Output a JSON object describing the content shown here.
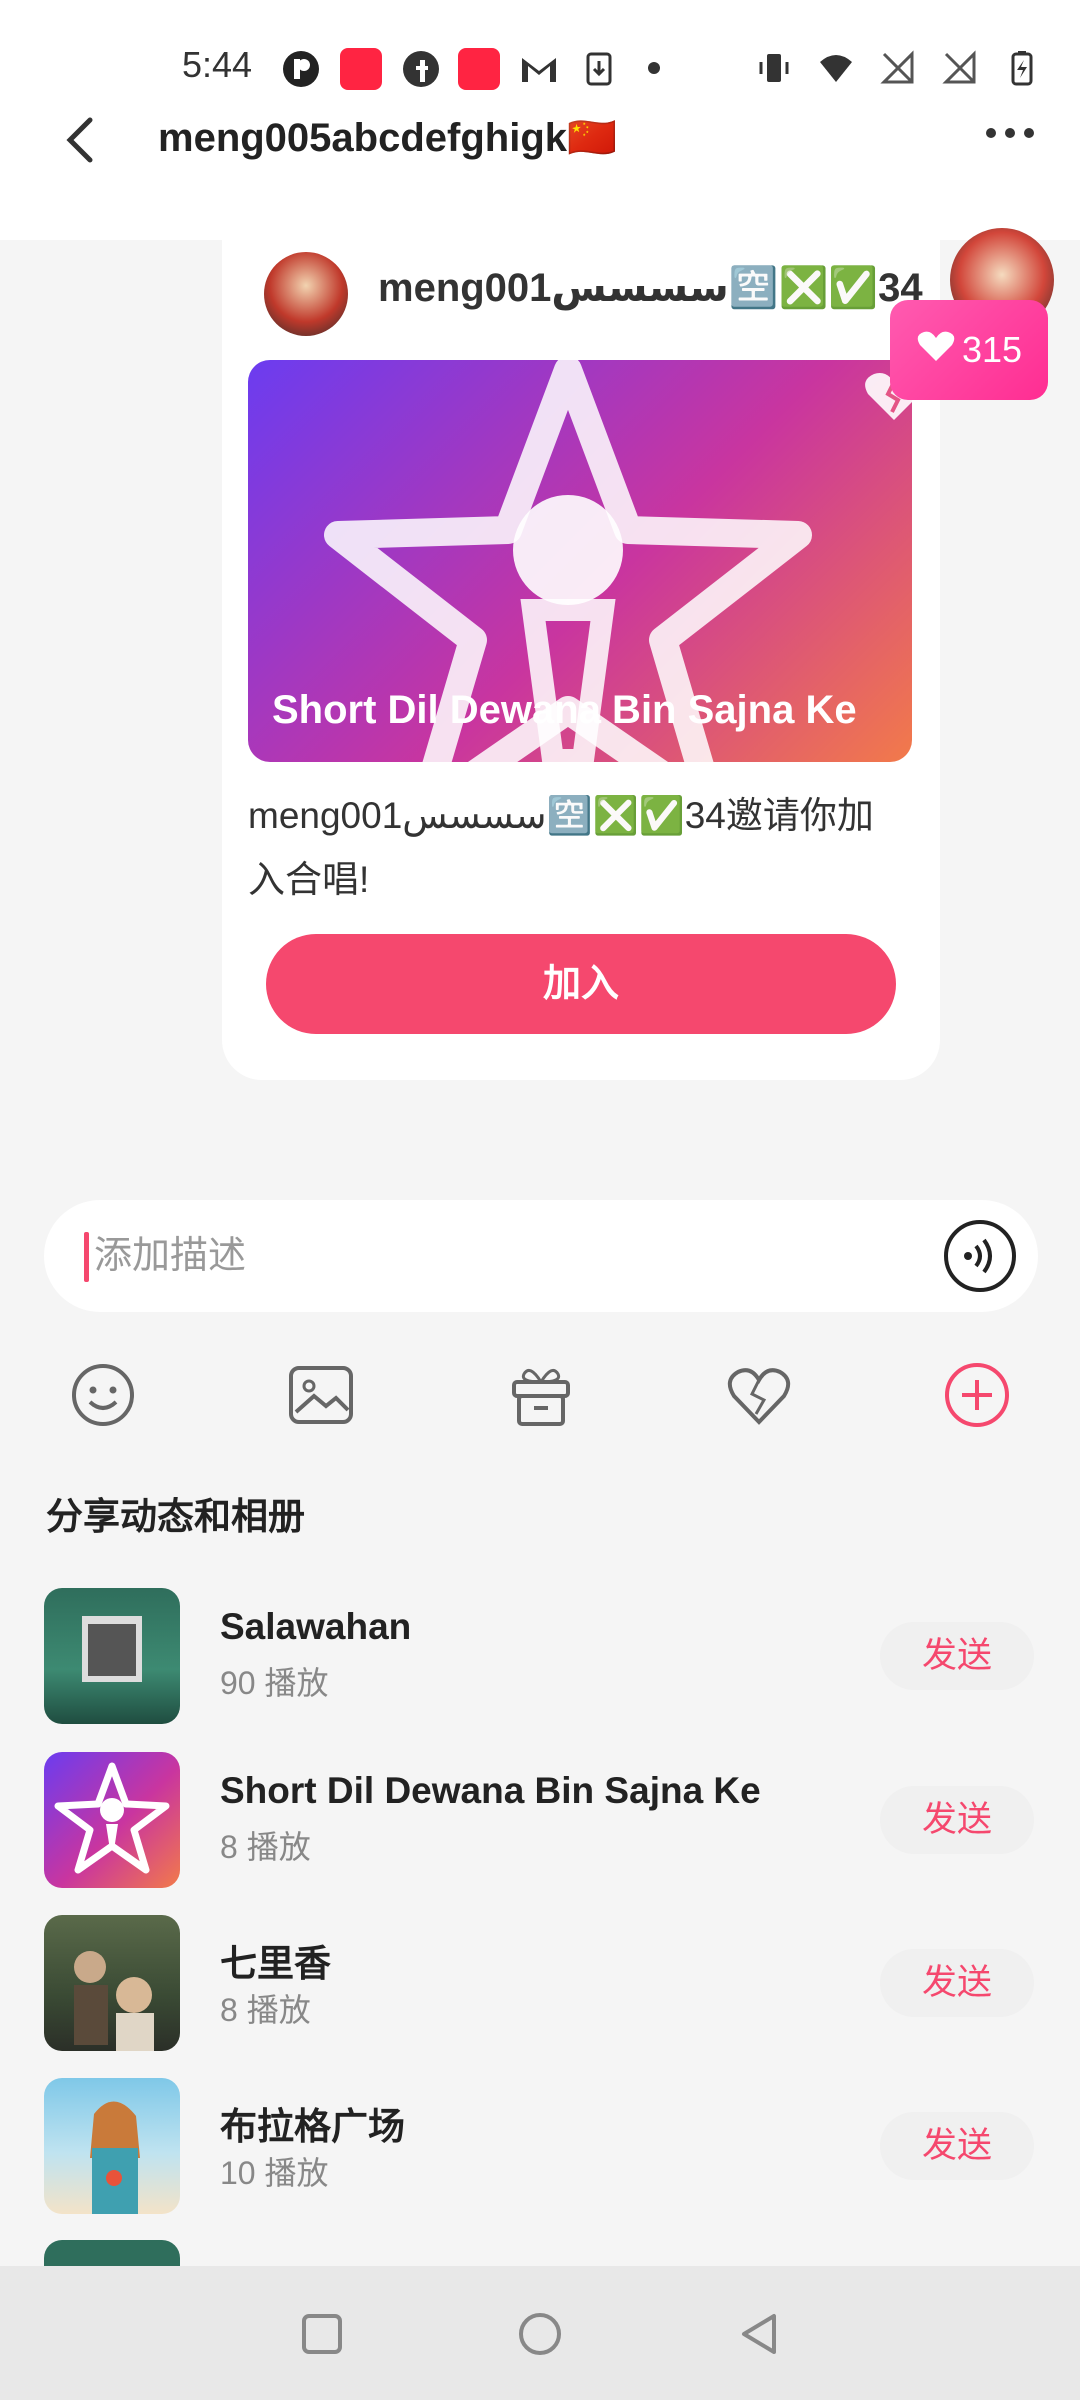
{
  "status_bar": {
    "time": "5:44",
    "left_icons": [
      "p-icon",
      "xiaohongshu-icon",
      "facebook-icon",
      "xiaohongshu-icon",
      "gmail-icon",
      "download-icon",
      "dot-icon"
    ],
    "right_icons": [
      "vibrate-icon",
      "wifi-icon",
      "no-signal-icon",
      "no-signal-icon",
      "battery-charging-icon"
    ]
  },
  "header": {
    "title": "meng005abcdefghigk🇨🇳"
  },
  "card": {
    "username": "meng001سسسس🈳❎✅34",
    "cover_title": "Short Dil Dewana Bin Sajna Ke",
    "invite_text": "meng001سسسس🈳❎✅34邀请你加入合唱!",
    "join_label": "加入"
  },
  "likes": {
    "count": "315"
  },
  "input": {
    "placeholder": "添加描述"
  },
  "toolbar": [
    "emoji-icon",
    "image-icon",
    "gift-icon",
    "heart-icon",
    "plus-icon"
  ],
  "share": {
    "title": "分享动态和相册",
    "items": [
      {
        "name": "Salawahan",
        "plays": "90 播放",
        "send": "发送"
      },
      {
        "name": "Short Dil Dewana Bin Sajna Ke",
        "plays": "8 播放",
        "send": "发送"
      },
      {
        "name": "七里香",
        "plays": "8 播放",
        "send": "发送"
      },
      {
        "name": "布拉格广场",
        "plays": "10 播放",
        "send": "发送"
      }
    ]
  },
  "colors": {
    "accent": "#f5486e",
    "likes": "#ff2d92"
  }
}
